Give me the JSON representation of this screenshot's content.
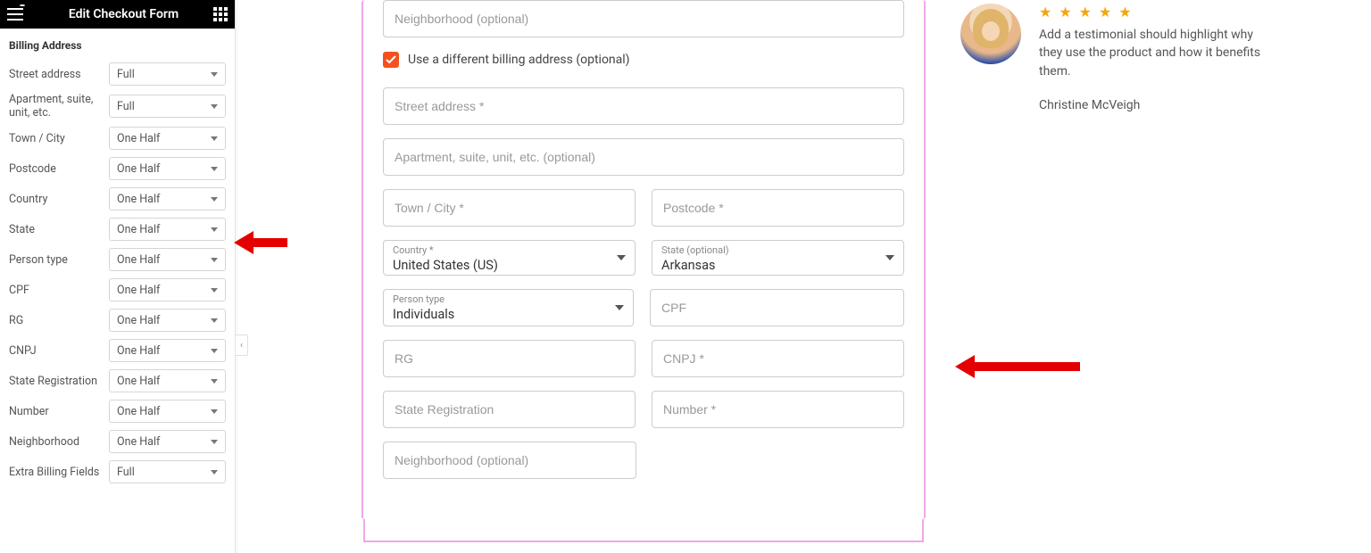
{
  "sidebar": {
    "title": "Edit Checkout Form",
    "section": "Billing Address",
    "fields": [
      {
        "label": "Street address",
        "value": "Full"
      },
      {
        "label": "Apartment, suite, unit, etc.",
        "value": "Full"
      },
      {
        "label": "Town / City",
        "value": "One Half"
      },
      {
        "label": "Postcode",
        "value": "One Half"
      },
      {
        "label": "Country",
        "value": "One Half"
      },
      {
        "label": "State",
        "value": "One Half"
      },
      {
        "label": "Person type",
        "value": "One Half"
      },
      {
        "label": "CPF",
        "value": "One Half"
      },
      {
        "label": "RG",
        "value": "One Half"
      },
      {
        "label": "CNPJ",
        "value": "One Half"
      },
      {
        "label": "State Registration",
        "value": "One Half"
      },
      {
        "label": "Number",
        "value": "One Half"
      },
      {
        "label": "Neighborhood",
        "value": "One Half"
      },
      {
        "label": "Extra Billing Fields",
        "value": "Full"
      }
    ]
  },
  "form": {
    "neighborhood0_ph": "Neighborhood (optional)",
    "diff_billing_label": "Use a different billing address (optional)",
    "street_ph": "Street address *",
    "apt_ph": "Apartment, suite, unit, etc. (optional)",
    "town_ph": "Town / City *",
    "postcode_ph": "Postcode *",
    "country_label": "Country *",
    "country_value": "United States (US)",
    "state_label": "State (optional)",
    "state_value": "Arkansas",
    "person_label": "Person type",
    "person_value": "Individuals",
    "cpf_ph": "CPF",
    "rg_ph": "RG",
    "cnpj_ph": "CNPJ *",
    "statereg_ph": "State Registration",
    "number_ph": "Number *",
    "neighborhood_ph": "Neighborhood (optional)"
  },
  "testimonial": {
    "stars": "★ ★ ★ ★ ★",
    "text": "Add a testimonial should highlight why they use the product and how it benefits them.",
    "author": "Christine McVeigh"
  }
}
